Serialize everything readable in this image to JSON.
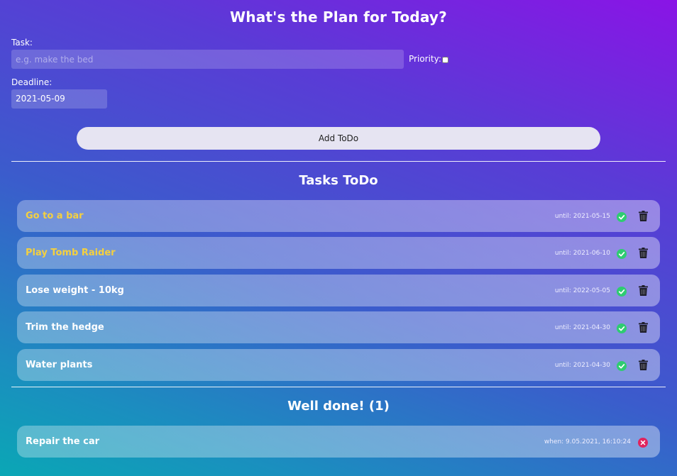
{
  "header": {
    "title": "What's the Plan for Today?"
  },
  "form": {
    "task_label": "Task:",
    "task_placeholder": "e.g. make the bed",
    "priority_label": "Priority:",
    "deadline_label": "Deadline:",
    "deadline_value": "2021-05-09",
    "add_button_label": "Add ToDo"
  },
  "todo": {
    "title": "Tasks ToDo",
    "items": [
      {
        "text": "Go to a bar",
        "date": "until: 2021-05-15",
        "priority": true
      },
      {
        "text": "Play Tomb Raider",
        "date": "until: 2021-06-10",
        "priority": true
      },
      {
        "text": "Lose weight - 10kg",
        "date": "until: 2022-05-05",
        "priority": false
      },
      {
        "text": "Trim the hedge",
        "date": "until: 2021-04-30",
        "priority": false
      },
      {
        "text": "Water plants",
        "date": "until: 2021-04-30",
        "priority": false
      }
    ]
  },
  "done": {
    "title": "Well done! (1)",
    "items": [
      {
        "text": "Repair the car",
        "date": "when: 9.05.2021, 16:10:24"
      }
    ]
  },
  "icons": {
    "check": "check-circle-icon",
    "trash": "trash-icon",
    "remove": "remove-circle-icon"
  },
  "colors": {
    "priority_text": "#f4d03f",
    "check": "#2ecc71",
    "remove": "#e0245e"
  }
}
